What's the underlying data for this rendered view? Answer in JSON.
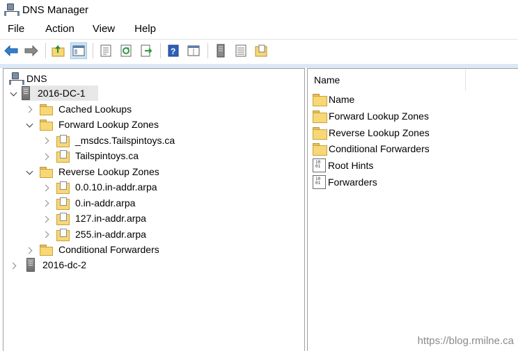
{
  "window": {
    "title": "DNS Manager"
  },
  "menu": [
    "File",
    "Action",
    "View",
    "Help"
  ],
  "toolbar": {
    "buttons": [
      "back-arrow-icon",
      "forward-arrow-icon",
      "up-folder-icon",
      "show-hide-tree-icon",
      "properties-icon",
      "refresh-icon",
      "export-list-icon",
      "help-icon",
      "console-view-icon",
      "server-icon",
      "list-icon",
      "zone-icon"
    ],
    "active": "show-hide-tree-icon"
  },
  "tree": {
    "root": "DNS",
    "servers": [
      {
        "name": "2016-DC-1",
        "expanded": true,
        "selected": true,
        "children": [
          {
            "label": "Cached Lookups",
            "expanded": false,
            "children": []
          },
          {
            "label": "Forward Lookup Zones",
            "expanded": true,
            "children": [
              "_msdcs.Tailspintoys.ca",
              "Tailspintoys.ca"
            ]
          },
          {
            "label": "Reverse Lookup Zones",
            "expanded": true,
            "children": [
              "0.0.10.in-addr.arpa",
              "0.in-addr.arpa",
              "127.in-addr.arpa",
              "255.in-addr.arpa"
            ]
          },
          {
            "label": "Conditional Forwarders",
            "expanded": false,
            "children": []
          }
        ]
      },
      {
        "name": "2016-dc-2",
        "expanded": false,
        "selected": false,
        "children": []
      }
    ]
  },
  "list": {
    "column_header": "Name",
    "items": [
      {
        "label": "Name",
        "icon": "folder-icon"
      },
      {
        "label": "Forward Lookup Zones",
        "icon": "folder-icon"
      },
      {
        "label": "Reverse Lookup Zones",
        "icon": "folder-icon"
      },
      {
        "label": "Conditional Forwarders",
        "icon": "folder-icon"
      },
      {
        "label": "Root Hints",
        "icon": "record-icon"
      },
      {
        "label": "Forwarders",
        "icon": "record-icon"
      }
    ]
  },
  "watermark": "https://blog.rmilne.ca",
  "colors": {
    "folder": "#f8d775",
    "selection": "#e5e5e5",
    "toolbar_active": "#cce4f7",
    "pane_border": "#a0a0a0"
  }
}
